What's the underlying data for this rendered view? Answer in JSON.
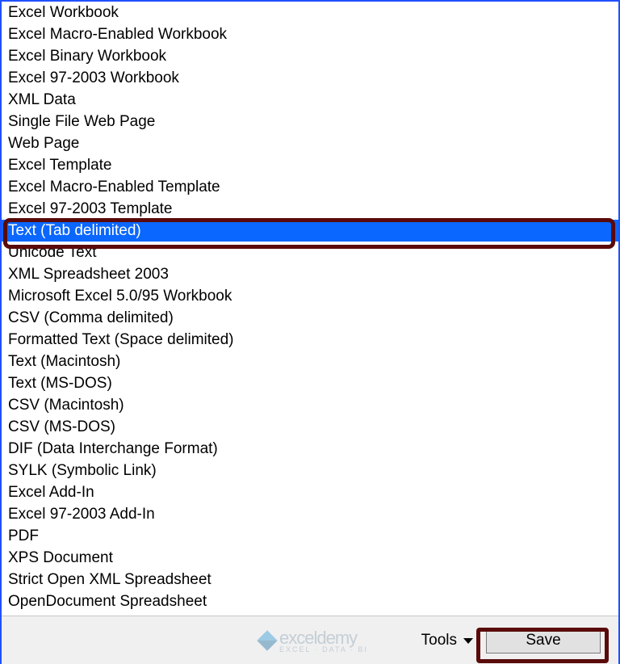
{
  "file_types": [
    "Excel Workbook",
    "Excel Macro-Enabled Workbook",
    "Excel Binary Workbook",
    "Excel 97-2003 Workbook",
    "XML Data",
    "Single File Web Page",
    "Web Page",
    "Excel Template",
    "Excel Macro-Enabled Template",
    "Excel 97-2003 Template",
    "Text (Tab delimited)",
    "Unicode Text",
    "XML Spreadsheet 2003",
    "Microsoft Excel 5.0/95 Workbook",
    "CSV (Comma delimited)",
    "Formatted Text (Space delimited)",
    "Text (Macintosh)",
    "Text (MS-DOS)",
    "CSV (Macintosh)",
    "CSV (MS-DOS)",
    "DIF (Data Interchange Format)",
    "SYLK (Symbolic Link)",
    "Excel Add-In",
    "Excel 97-2003 Add-In",
    "PDF",
    "XPS Document",
    "Strict Open XML Spreadsheet",
    "OpenDocument Spreadsheet"
  ],
  "selected_index": 10,
  "footer": {
    "tools_label": "Tools",
    "save_label": "Save"
  },
  "watermark": {
    "name": "exceldemy",
    "sub": "EXCEL · DATA · BI"
  }
}
